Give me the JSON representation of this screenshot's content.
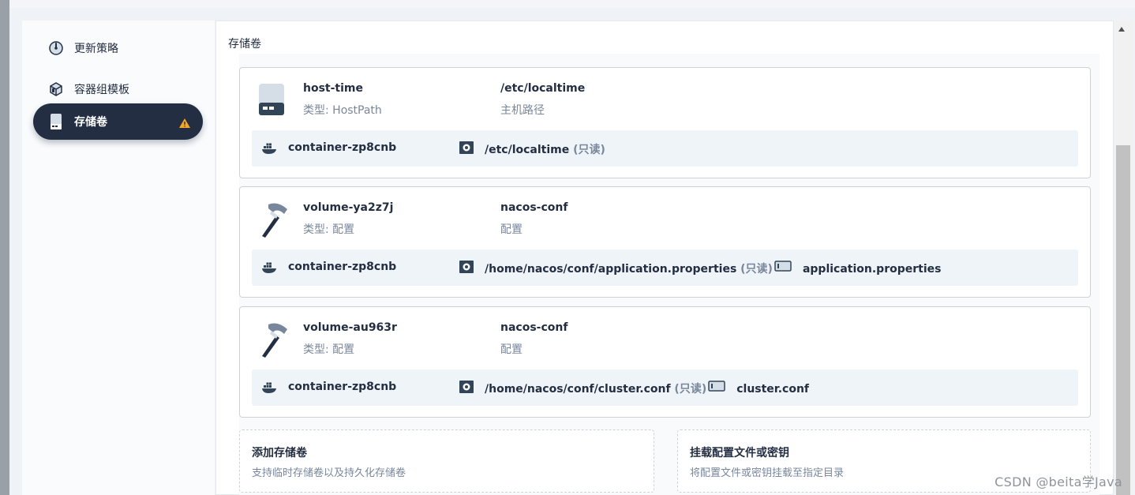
{
  "sidebar": {
    "items": [
      {
        "label": "更新策略",
        "icon": "gauge-icon"
      },
      {
        "label": "容器组模板",
        "icon": "pod-template-icon"
      },
      {
        "label": "存储卷",
        "icon": "disk-icon",
        "active": true,
        "warning": true
      }
    ]
  },
  "content": {
    "section_title": "存储卷",
    "volumes": [
      {
        "name": "host-time",
        "type": "类型: HostPath",
        "icon": "hard-disk-icon",
        "source": "/etc/localtime",
        "source_desc": "主机路径",
        "mount": {
          "container": "container-zp8cnb",
          "path": "/etc/localtime",
          "readonly": "(只读)",
          "key": ""
        }
      },
      {
        "name": "volume-ya2z7j",
        "type": "类型: 配置",
        "icon": "hammer-icon",
        "source": "nacos-conf",
        "source_desc": "配置",
        "mount": {
          "container": "container-zp8cnb",
          "path": "/home/nacos/conf/application.properties",
          "readonly": "(只读)",
          "key": "application.properties"
        }
      },
      {
        "name": "volume-au963r",
        "type": "类型: 配置",
        "icon": "hammer-icon",
        "source": "nacos-conf",
        "source_desc": "配置",
        "mount": {
          "container": "container-zp8cnb",
          "path": "/home/nacos/conf/cluster.conf",
          "readonly": "(只读)",
          "key": "cluster.conf"
        }
      }
    ],
    "add_volume": {
      "title": "添加存储卷",
      "desc": "支持临时存储卷以及持久化存储卷"
    },
    "mount_config": {
      "title": "挂载配置文件或密钥",
      "desc": "将配置文件或密钥挂载至指定目录"
    }
  },
  "watermark": "CSDN @beita学Java",
  "colors": {
    "accent": "#242e42",
    "muted": "#79879c",
    "warning": "#f5a623"
  }
}
